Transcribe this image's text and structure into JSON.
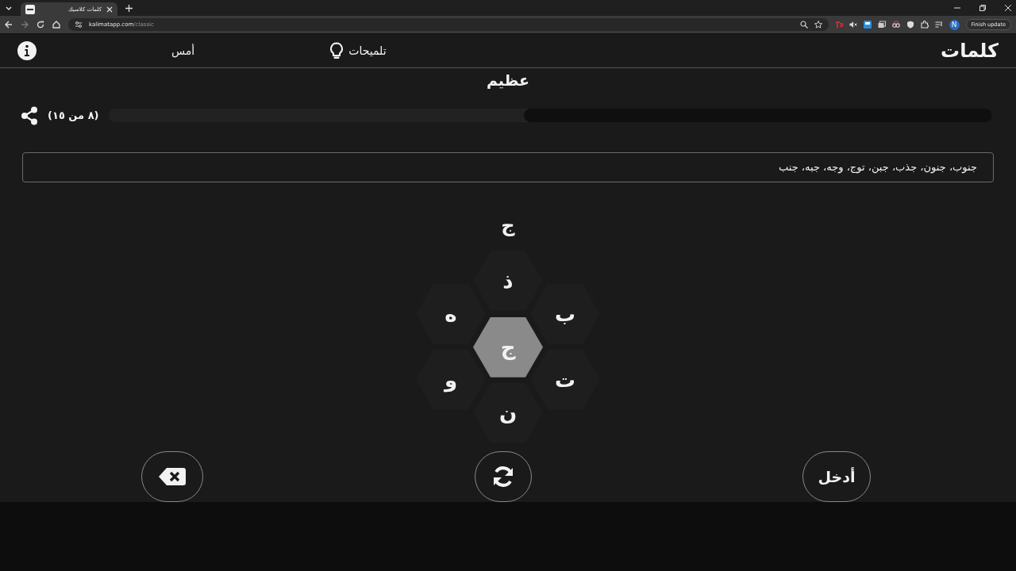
{
  "browser": {
    "tab_title": "كلمات كلاسيك",
    "url_host": "kalimatapp.com",
    "url_path": "/classic",
    "update_button": "Finish update",
    "profile_initial": "N"
  },
  "header": {
    "logo": "كلمات",
    "hints": "تلميحات",
    "yesterday": "أمس"
  },
  "rank": "عظيم",
  "progress": {
    "level": 0.53,
    "reading": "(٨ من ١٥)"
  },
  "found_words": "جنوب، جنون، جذب، جبن، توج، وجه، جبه، جنب",
  "current_input": "ج",
  "letters": [
    {
      "letter": "ذ",
      "selected": false
    },
    {
      "letter": "ه",
      "selected": false
    },
    {
      "letter": "ب",
      "selected": false
    },
    {
      "letter": "ج",
      "selected": true
    },
    {
      "letter": "و",
      "selected": false
    },
    {
      "letter": "ت",
      "selected": false
    },
    {
      "letter": "ن",
      "selected": false
    }
  ],
  "buttons": {
    "enter": "أدخل"
  }
}
